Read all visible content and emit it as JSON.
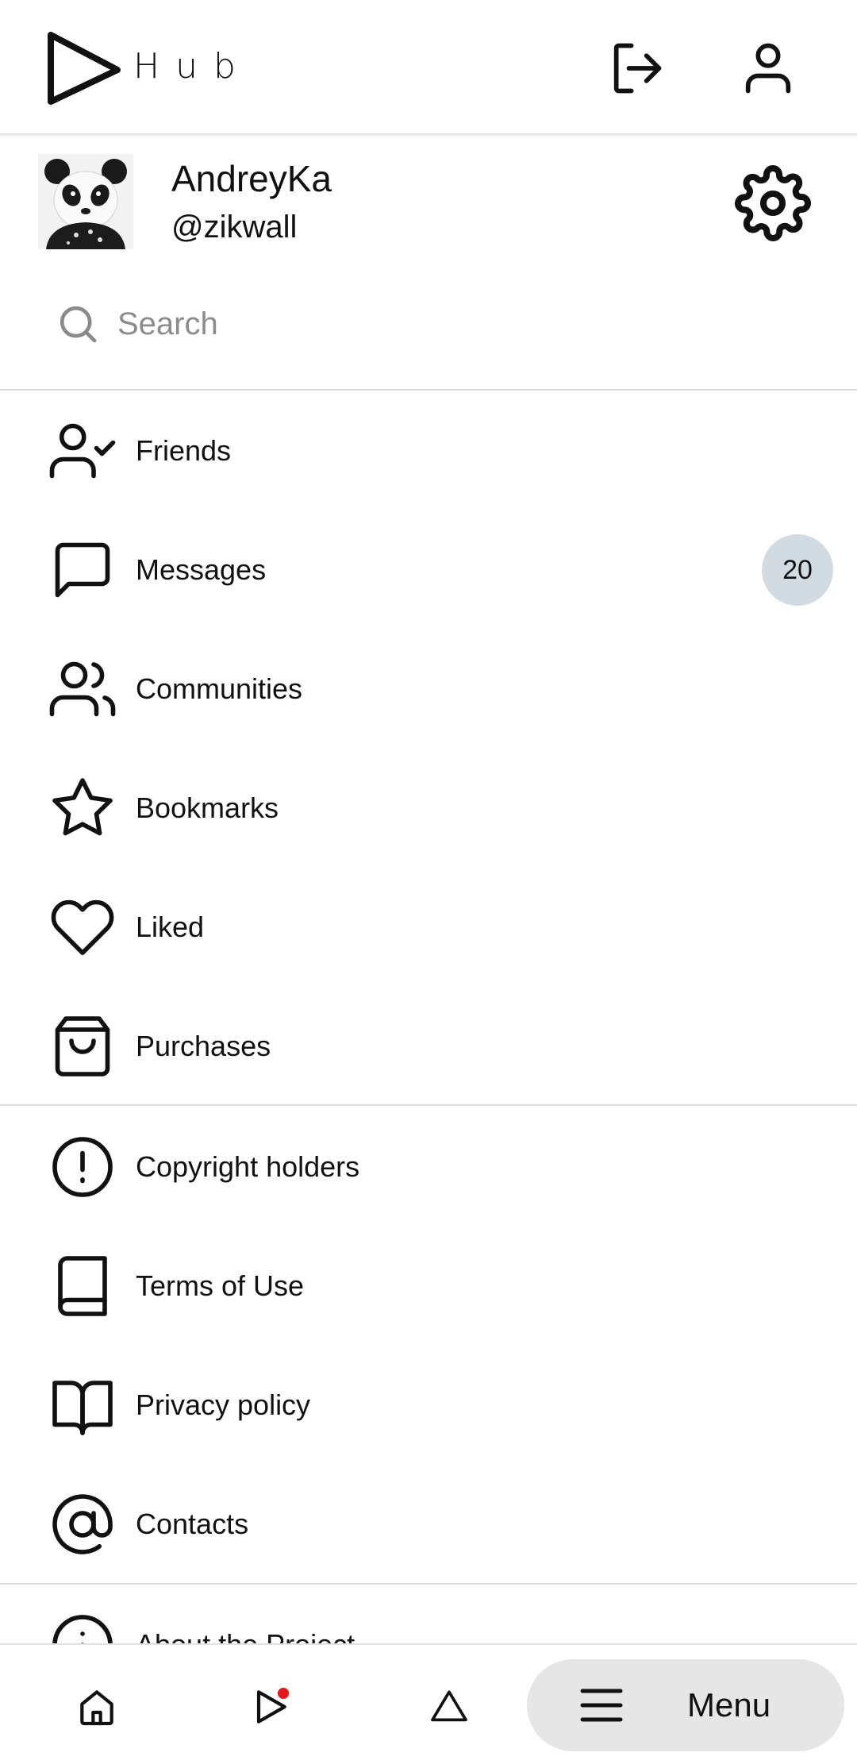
{
  "header": {
    "logo_text": "Hub"
  },
  "profile": {
    "name": "AndreyKa",
    "handle": "@zikwall"
  },
  "search": {
    "placeholder": "Search"
  },
  "menu": {
    "main_items": [
      {
        "label": "Friends",
        "icon": "user-check-icon"
      },
      {
        "label": "Messages",
        "icon": "message-square-icon",
        "badge": "20"
      },
      {
        "label": "Communities",
        "icon": "users-icon"
      },
      {
        "label": "Bookmarks",
        "icon": "star-icon"
      },
      {
        "label": "Liked",
        "icon": "heart-icon"
      },
      {
        "label": "Purchases",
        "icon": "shopping-bag-icon"
      }
    ],
    "info_items": [
      {
        "label": "Copyright holders",
        "icon": "alert-circle-icon"
      },
      {
        "label": "Terms of Use",
        "icon": "book-icon"
      },
      {
        "label": "Privacy policy",
        "icon": "book-open-icon"
      },
      {
        "label": "Contacts",
        "icon": "at-sign-icon"
      },
      {
        "label": "About the Project",
        "icon": "info-icon"
      }
    ]
  },
  "bottom_nav": {
    "menu_label": "Menu",
    "notification_color": "#e8161c"
  }
}
